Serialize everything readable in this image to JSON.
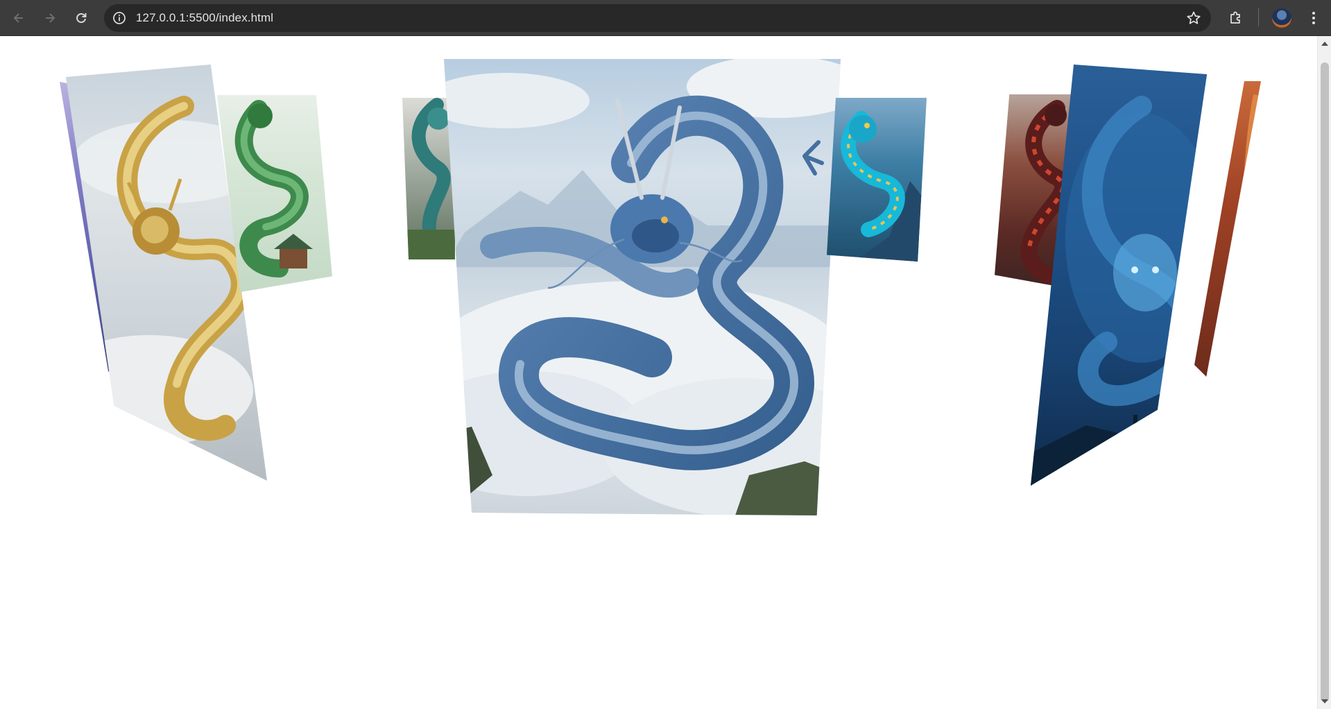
{
  "browser": {
    "url": "127.0.0.1:5500/index.html",
    "back_icon": "arrow-left-icon",
    "forward_icon": "arrow-right-icon",
    "reload_icon": "reload-icon",
    "site_info_icon": "info-icon",
    "bookmark_icon": "star-icon",
    "extensions_icon": "puzzle-icon",
    "menu_icon": "kebab-menu-icon"
  },
  "carousel": {
    "cards": [
      {
        "name": "purple-dragon-card",
        "theme": "purple"
      },
      {
        "name": "golden-dragon-card",
        "theme": "gold"
      },
      {
        "name": "green-dragon-card",
        "theme": "green"
      },
      {
        "name": "teal-dragon-card",
        "theme": "teal"
      },
      {
        "name": "blue-cloud-dragon-card",
        "theme": "blue",
        "active": true
      },
      {
        "name": "cyan-dragon-card",
        "theme": "cyan"
      },
      {
        "name": "red-dragon-card",
        "theme": "red"
      },
      {
        "name": "deep-blue-dragon-card",
        "theme": "deep-blue"
      },
      {
        "name": "orange-dragon-card",
        "theme": "orange"
      }
    ]
  },
  "colors": {
    "chrome_bg": "#3c3c3c",
    "omnibox_bg": "#282828",
    "page_bg": "#ffffff"
  }
}
